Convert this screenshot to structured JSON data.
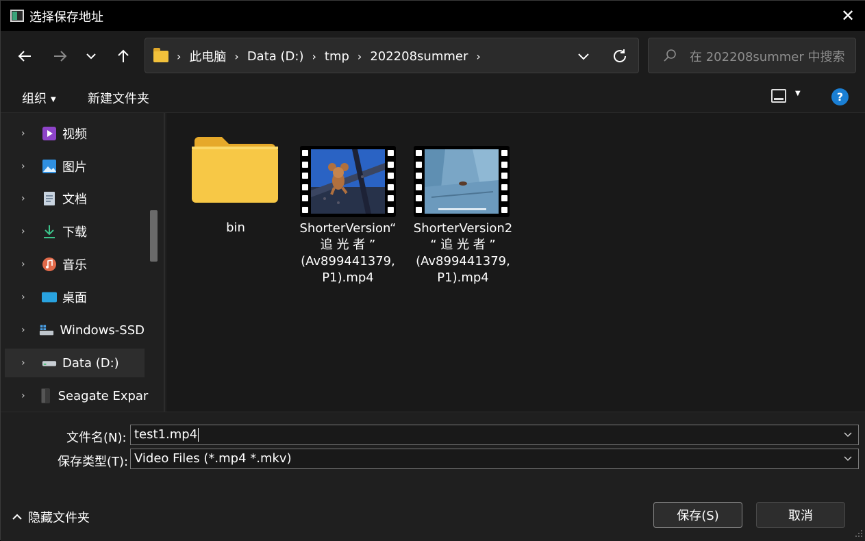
{
  "window": {
    "title": "选择保存地址",
    "close_glyph": "✕"
  },
  "nav": {
    "breadcrumbs": [
      "此电脑",
      "Data (D:)",
      "tmp",
      "202208summer"
    ],
    "search_placeholder": "在 202208summer 中搜索"
  },
  "toolbar": {
    "organize": "组织",
    "new_folder": "新建文件夹",
    "help": "?"
  },
  "sidebar": {
    "items": [
      {
        "label": "视频",
        "icon": "video-icon"
      },
      {
        "label": "图片",
        "icon": "pictures-icon"
      },
      {
        "label": "文档",
        "icon": "documents-icon"
      },
      {
        "label": "下载",
        "icon": "downloads-icon"
      },
      {
        "label": "音乐",
        "icon": "music-icon"
      },
      {
        "label": "桌面",
        "icon": "desktop-icon"
      },
      {
        "label": "Windows-SSD",
        "icon": "windows-drive-icon"
      },
      {
        "label": "Data (D:)",
        "icon": "drive-icon",
        "selected": true
      },
      {
        "label": "Seagate Expar",
        "icon": "external-drive-icon"
      }
    ]
  },
  "files": [
    {
      "name_lines": [
        "bin"
      ],
      "type": "folder"
    },
    {
      "name_lines": [
        "ShorterVersion“",
        "追 光 者 ”",
        "(Av899441379,",
        "P1).mp4"
      ],
      "type": "video"
    },
    {
      "name_lines": [
        "ShorterVersion2",
        "“ 追 光 者 ”",
        "(Av899441379,",
        "P1).mp4"
      ],
      "type": "video"
    }
  ],
  "form": {
    "filename_label": "文件名(N):",
    "filename_value": "test1.mp4",
    "filetype_label": "保存类型(T):",
    "filetype_value": "Video Files (*.mp4 *.mkv)"
  },
  "footer": {
    "hide_folders": "隐藏文件夹",
    "save": "保存(S)",
    "cancel": "取消"
  },
  "colors": {
    "accent": "#1a7fd4",
    "folder": "#f2c13b",
    "background": "#202020"
  }
}
